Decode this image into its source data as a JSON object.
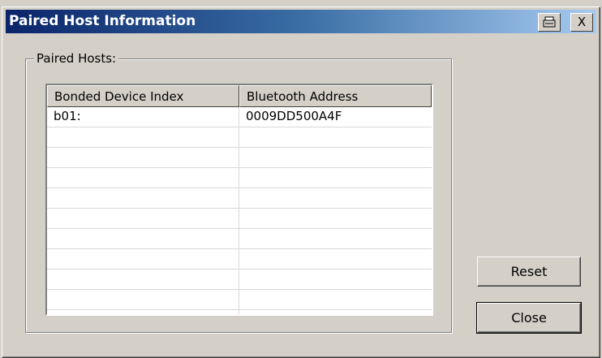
{
  "window": {
    "title": "Paired Host Information",
    "print_icon": "print-icon",
    "close_icon": "close-icon",
    "close_glyph": "X"
  },
  "group": {
    "label": "Paired Hosts:"
  },
  "table": {
    "columns": [
      "Bonded Device Index",
      "Bluetooth Address"
    ],
    "rows": [
      [
        "b01:",
        "0009DD500A4F"
      ],
      [
        "",
        ""
      ],
      [
        "",
        ""
      ],
      [
        "",
        ""
      ],
      [
        "",
        ""
      ],
      [
        "",
        ""
      ],
      [
        "",
        ""
      ],
      [
        "",
        ""
      ],
      [
        "",
        ""
      ],
      [
        "",
        ""
      ],
      [
        "",
        ""
      ]
    ]
  },
  "buttons": {
    "reset": "Reset",
    "close": "Close"
  }
}
